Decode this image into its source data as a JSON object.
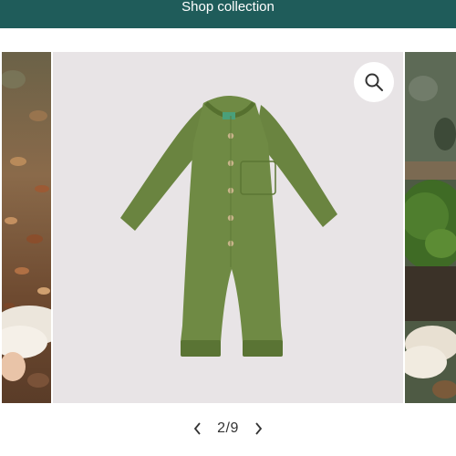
{
  "banner": {
    "label": "Shop collection"
  },
  "gallery": {
    "current": 2,
    "total": 9,
    "counter": "2/9",
    "zoom_icon": "search-icon",
    "prev_icon": "chevron-left-icon",
    "next_icon": "chevron-right-icon"
  },
  "colors": {
    "banner_bg": "#1f5c5a",
    "banner_text": "#ffffff",
    "product_bg": "#e8e4e6",
    "garment": "#6a8440"
  }
}
